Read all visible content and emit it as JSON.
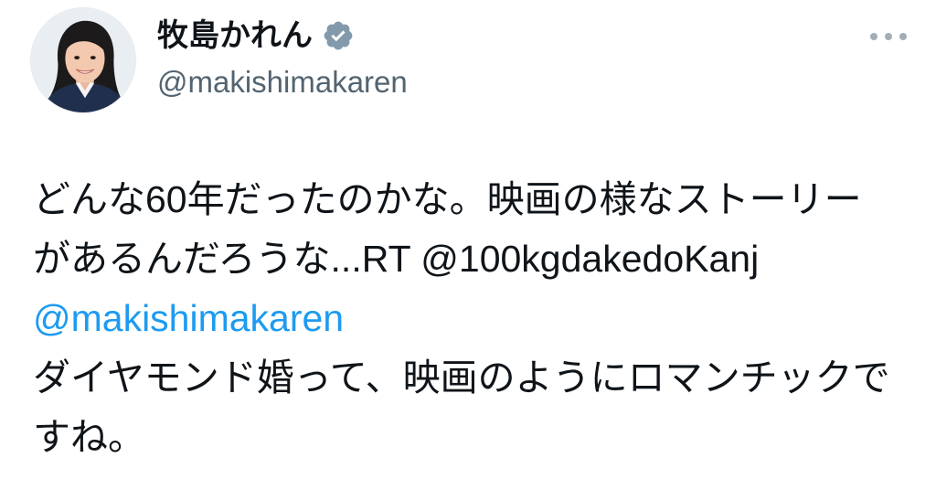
{
  "author": {
    "name": "牧島かれん",
    "handle": "@makishimakaren",
    "avatar_icon": "profile-photo",
    "verified_icon": "verified-badge-icon"
  },
  "menu": {
    "icon": "more-icon"
  },
  "tweet": {
    "lines": [
      "どんな60年だったのかな。映画の様なストーリー",
      "があるんだろうな...RT @100kgdakedoKanj",
      "@makishimakaren",
      "ダイヤモンド婚って、映画のようにロマンチックで",
      "すね。"
    ]
  },
  "colors": {
    "text": "#0f1419",
    "secondary": "#536471",
    "link": "#1d9bf0",
    "badge": "#829aab"
  }
}
